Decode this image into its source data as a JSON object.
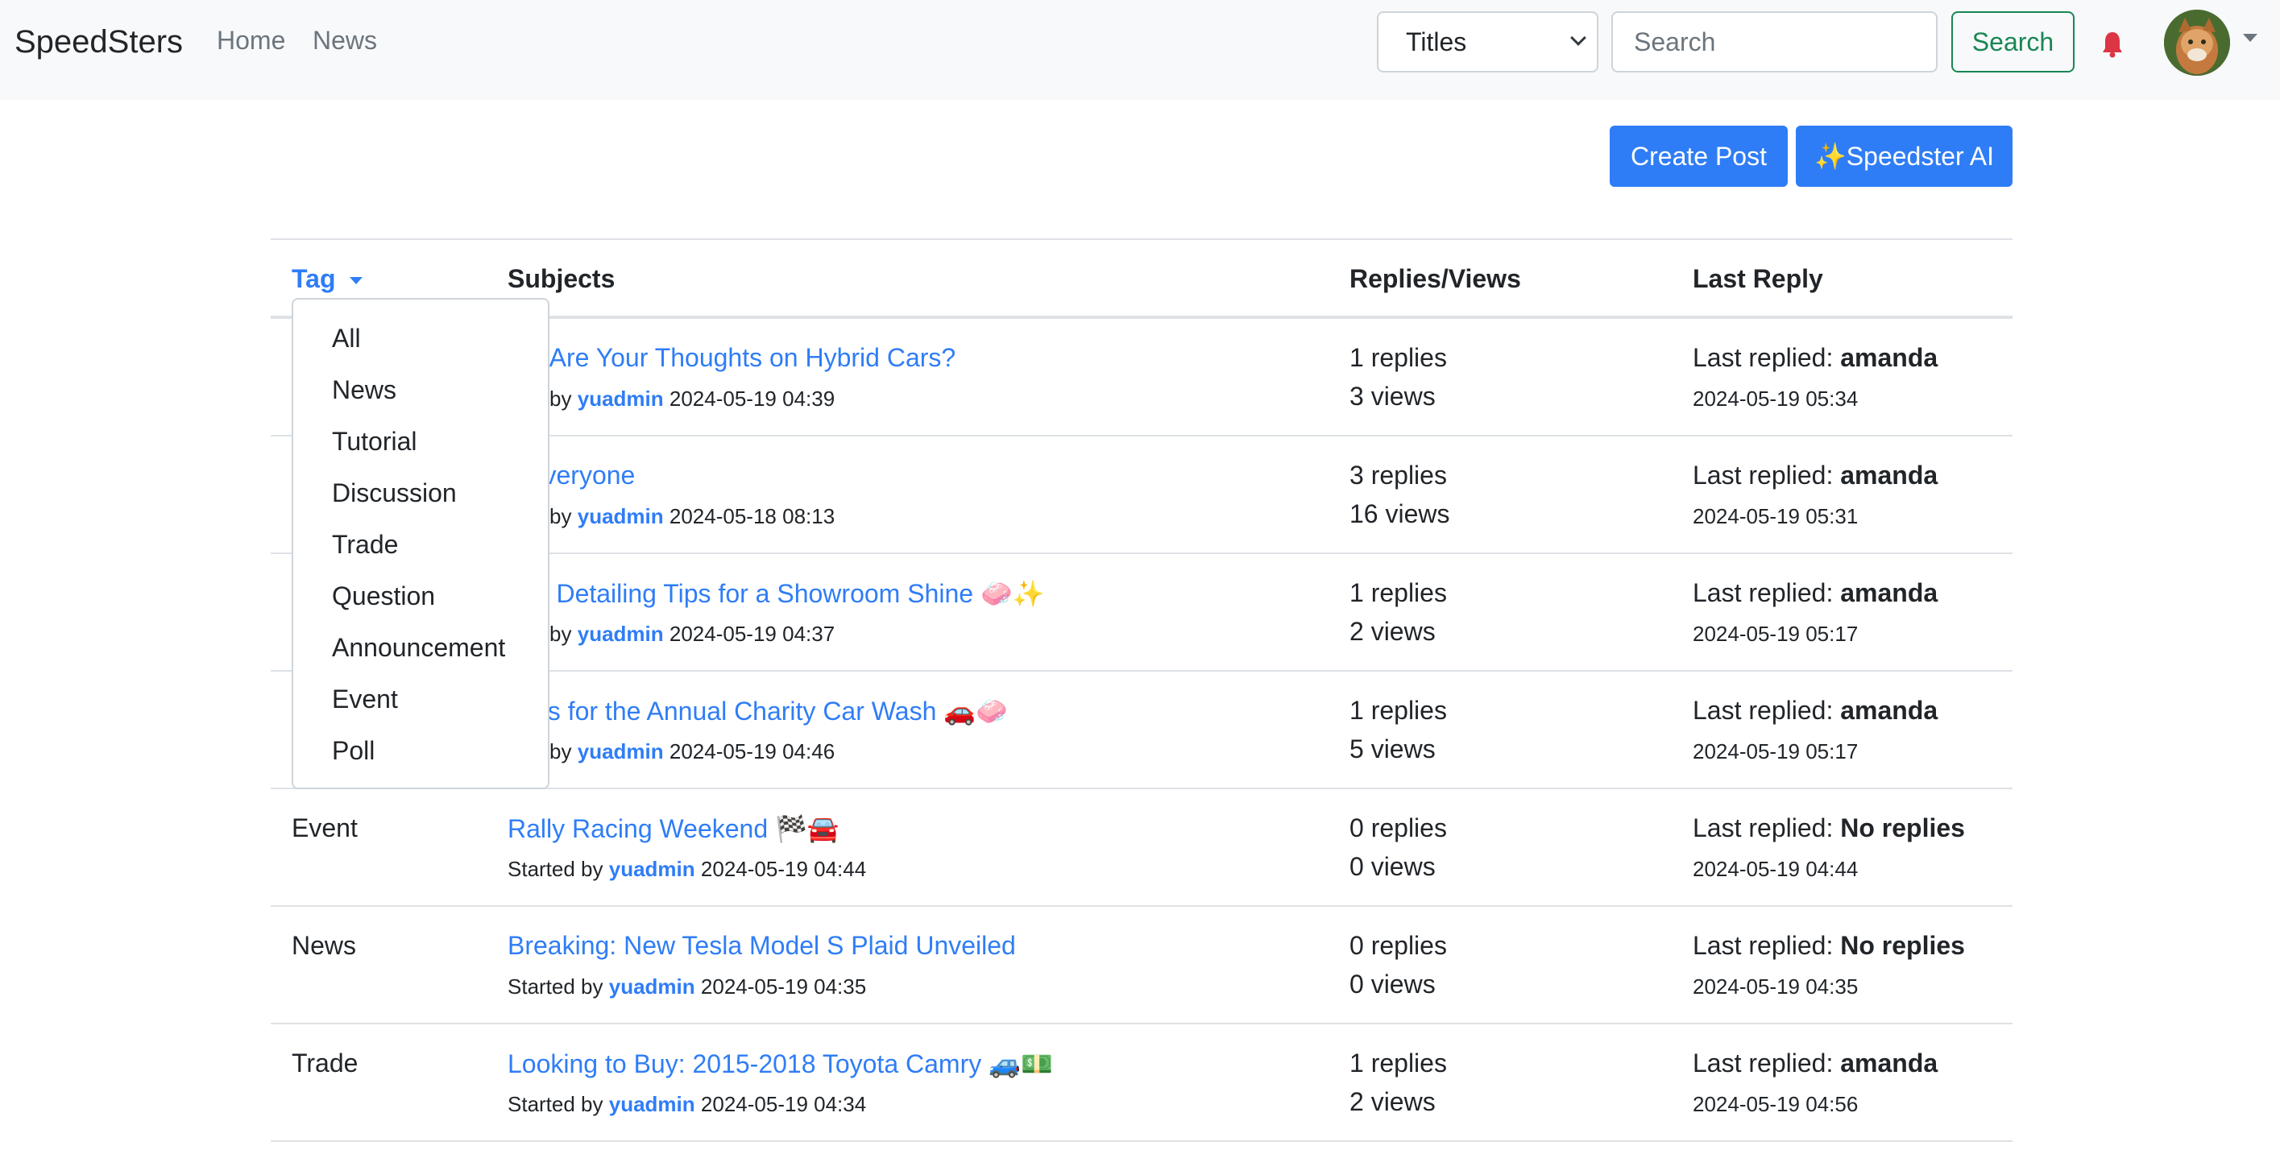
{
  "navbar": {
    "brand": "SpeedSters",
    "links": [
      "Home",
      "News"
    ],
    "filter_select": "Titles",
    "search_placeholder": "Search",
    "search_button": "Search",
    "bell_icon": "bell-icon",
    "bell_color": "#dc3545"
  },
  "actions": {
    "create_post": "Create Post",
    "speedster_ai": "✨Speedster AI"
  },
  "colors": {
    "primary": "#2f7df6",
    "success": "#198754",
    "navbar_bg": "#f8f9fa"
  },
  "table": {
    "headers": {
      "tag": "Tag",
      "subjects": "Subjects",
      "replies_views": "Replies/Views",
      "last_reply": "Last Reply"
    },
    "rows": [
      {
        "tag": "",
        "title": "hat Are Your Thoughts on Hybrid Cars?",
        "started_prefix": "rted by",
        "author": "yuadmin",
        "date": "2024-05-19 04:39",
        "replies": "1 replies",
        "views": "3 views",
        "last_prefix": "Last replied:",
        "last_user": "amanda",
        "last_date": "2024-05-19 05:34"
      },
      {
        "tag": "",
        "title": "o everyone",
        "started_prefix": "rted by",
        "author": "yuadmin",
        "date": "2024-05-18 08:13",
        "replies": "3 replies",
        "views": "16 views",
        "last_prefix": "Last replied:",
        "last_user": "amanda",
        "last_date": "2024-05-19 05:31"
      },
      {
        "tag": "",
        "title": "Car Detailing Tips for a Showroom Shine 🧼✨",
        "started_prefix": "rted by",
        "author": "yuadmin",
        "date": "2024-05-19 04:37",
        "replies": "1 replies",
        "views": "2 views",
        "last_prefix": "Last replied:",
        "last_user": "amanda",
        "last_date": "2024-05-19 05:17"
      },
      {
        "tag": "",
        "title": "n Us for the Annual Charity Car Wash 🚗🧼",
        "started_prefix": "rted by",
        "author": "yuadmin",
        "date": "2024-05-19 04:46",
        "replies": "1 replies",
        "views": "5 views",
        "last_prefix": "Last replied:",
        "last_user": "amanda",
        "last_date": "2024-05-19 05:17"
      },
      {
        "tag": "Event",
        "title": "Rally Racing Weekend 🏁🚘",
        "started_prefix": "Started by",
        "author": "yuadmin",
        "date": "2024-05-19 04:44",
        "replies": "0 replies",
        "views": "0 views",
        "last_prefix": "Last replied:",
        "last_user": "No replies",
        "last_date": "2024-05-19 04:44"
      },
      {
        "tag": "News",
        "title": "Breaking: New Tesla Model S Plaid Unveiled",
        "started_prefix": "Started by",
        "author": "yuadmin",
        "date": "2024-05-19 04:35",
        "replies": "0 replies",
        "views": "0 views",
        "last_prefix": "Last replied:",
        "last_user": "No replies",
        "last_date": "2024-05-19 04:35"
      },
      {
        "tag": "Trade",
        "title": "Looking to Buy: 2015-2018 Toyota Camry 🚙💵",
        "started_prefix": "Started by",
        "author": "yuadmin",
        "date": "2024-05-19 04:34",
        "replies": "1 replies",
        "views": "2 views",
        "last_prefix": "Last replied:",
        "last_user": "amanda",
        "last_date": "2024-05-19 04:56"
      }
    ]
  },
  "tag_dropdown": {
    "items": [
      "All",
      "News",
      "Tutorial",
      "Discussion",
      "Trade",
      "Question",
      "Announcement",
      "Event",
      "Poll"
    ]
  }
}
